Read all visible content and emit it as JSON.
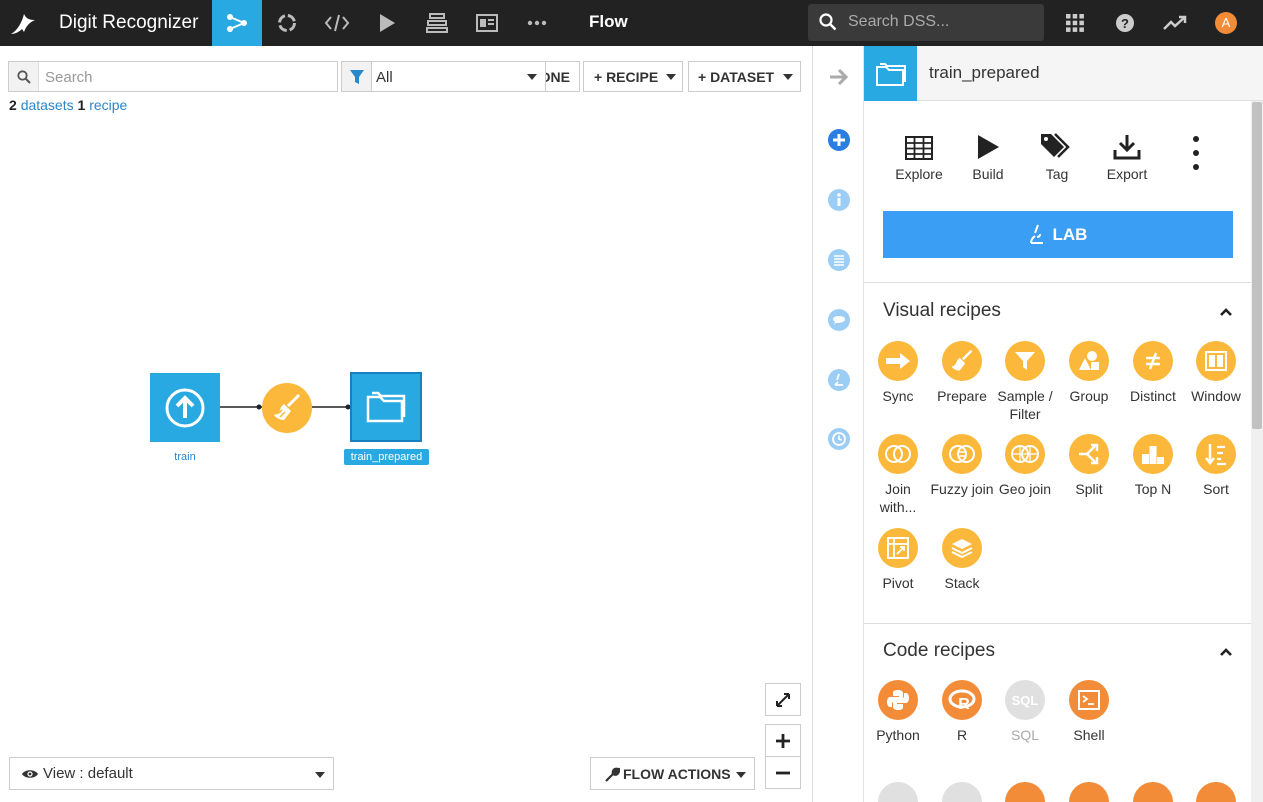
{
  "topbar": {
    "project_name": "Digit Recognizer",
    "current_section": "Flow",
    "search_placeholder": "Search DSS...",
    "avatar_initial": "A"
  },
  "toolbar": {
    "search_placeholder": "Search",
    "filter_value": "All",
    "zone_button_label": "ONE",
    "recipe_button_label": "+ RECIPE",
    "dataset_button_label": "+ DATASET"
  },
  "counts": {
    "datasets_count": "2",
    "datasets_label": "datasets",
    "recipes_count": "1",
    "recipes_label": "recipe"
  },
  "flow": {
    "nodes": [
      {
        "label": "train",
        "type": "dataset-upload"
      },
      {
        "label": "",
        "type": "recipe-prepare"
      },
      {
        "label": "train_prepared",
        "type": "dataset-folder",
        "selected": true
      }
    ]
  },
  "bottom": {
    "view_label": "View : default",
    "flow_actions_label": "FLOW ACTIONS"
  },
  "panel": {
    "title": "train_prepared",
    "actions": [
      {
        "label": "Explore",
        "icon": "table-icon"
      },
      {
        "label": "Build",
        "icon": "play-icon"
      },
      {
        "label": "Tag",
        "icon": "tag-icon"
      },
      {
        "label": "Export",
        "icon": "download-icon"
      }
    ],
    "lab_label": "LAB",
    "visual_recipes_title": "Visual recipes",
    "visual_recipes": [
      {
        "label": "Sync",
        "icon": "arrow-right-icon"
      },
      {
        "label": "Prepare",
        "icon": "broom-icon"
      },
      {
        "label": "Sample / Filter",
        "icon": "funnel-icon"
      },
      {
        "label": "Group",
        "icon": "shapes-icon"
      },
      {
        "label": "Distinct",
        "icon": "not-equal-icon"
      },
      {
        "label": "Window",
        "icon": "window-icon"
      },
      {
        "label": "Join with...",
        "icon": "venn-icon"
      },
      {
        "label": "Fuzzy join",
        "icon": "fuzzy-venn-icon"
      },
      {
        "label": "Geo join",
        "icon": "globe-icon"
      },
      {
        "label": "Split",
        "icon": "split-icon"
      },
      {
        "label": "Top N",
        "icon": "podium-icon"
      },
      {
        "label": "Sort",
        "icon": "sort-icon"
      },
      {
        "label": "Pivot",
        "icon": "pivot-icon"
      },
      {
        "label": "Stack",
        "icon": "layers-icon"
      }
    ],
    "code_recipes_title": "Code recipes",
    "code_recipes": [
      {
        "label": "Python",
        "icon": "python-icon"
      },
      {
        "label": "R",
        "icon": "r-icon"
      },
      {
        "label": "SQL",
        "icon": "sql-icon",
        "disabled": true
      },
      {
        "label": "Shell",
        "icon": "terminal-icon"
      }
    ]
  },
  "colors": {
    "accent_blue": "#29a9e1",
    "lab_blue": "#3b9ef5",
    "visual_recipe_yellow": "#fbb83b",
    "code_recipe_orange": "#f28c38",
    "topbar_dark": "#222222"
  }
}
